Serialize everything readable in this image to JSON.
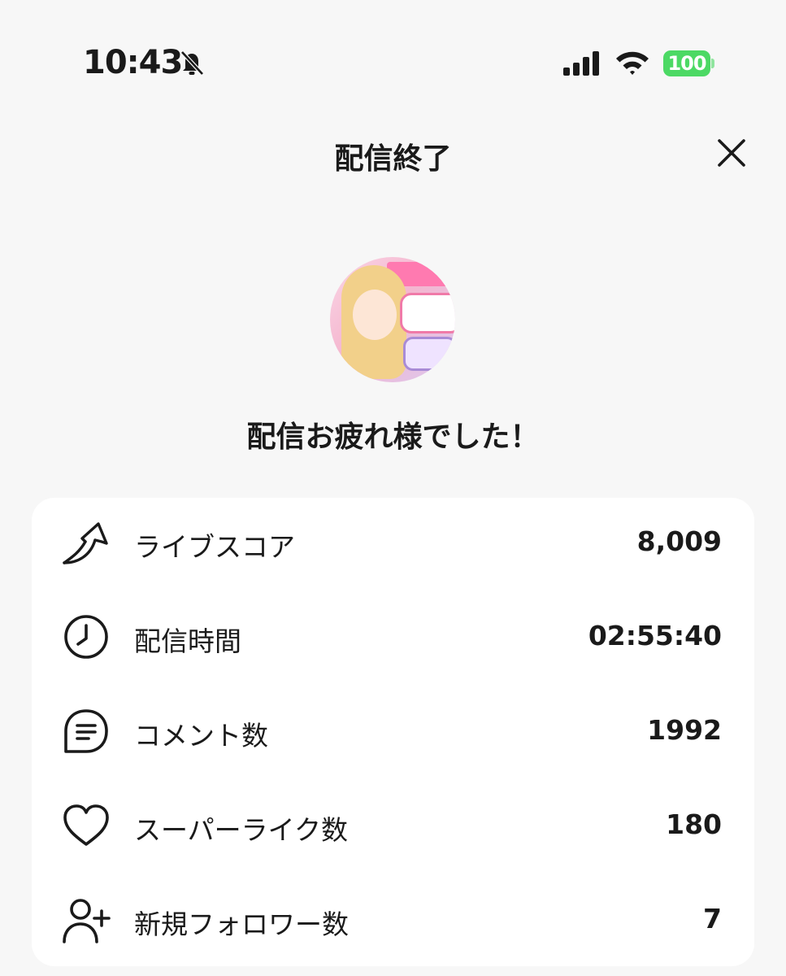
{
  "status_bar": {
    "time": "10:43",
    "battery": "100",
    "battery_color": "#4cd964",
    "icons": [
      "bell-slash-icon",
      "signal-icon",
      "wifi-icon",
      "battery-icon"
    ]
  },
  "header": {
    "title": "配信終了",
    "close_icon": "close-icon"
  },
  "avatar": {
    "icon": "avatar"
  },
  "greeting": "配信お疲れ様でした！",
  "stats": [
    {
      "icon": "score-arrow-icon",
      "label": "ライブスコア",
      "value": "8,009"
    },
    {
      "icon": "clock-icon",
      "label": "配信時間",
      "value": "02:55:40"
    },
    {
      "icon": "comment-icon",
      "label": "コメント数",
      "value": "1992"
    },
    {
      "icon": "heart-icon",
      "label": "スーパーライク数",
      "value": "180"
    },
    {
      "icon": "add-user-icon",
      "label": "新規フォロワー数",
      "value": "7"
    }
  ]
}
